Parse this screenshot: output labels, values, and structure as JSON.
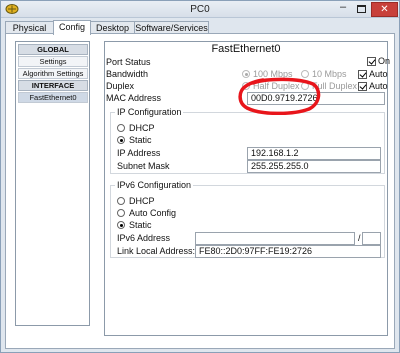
{
  "window": {
    "title": "PC0"
  },
  "tabs": [
    {
      "label": "Physical"
    },
    {
      "label": "Config"
    },
    {
      "label": "Desktop"
    },
    {
      "label": "Software/Services"
    }
  ],
  "sidebar": {
    "items": [
      {
        "label": "GLOBAL"
      },
      {
        "label": "Settings"
      },
      {
        "label": "Algorithm Settings"
      },
      {
        "label": "INTERFACE"
      },
      {
        "label": "FastEthernet0"
      }
    ]
  },
  "panel": {
    "title": "FastEthernet0",
    "port_status": {
      "label": "Port Status",
      "on_label": "On",
      "checked": true
    },
    "bandwidth": {
      "label": "Bandwidth",
      "opt_100": "100 Mbps",
      "opt_10": "10 Mbps",
      "auto_label": "Auto"
    },
    "duplex": {
      "label": "Duplex",
      "opt_half": "Half Duplex",
      "opt_full": "Full Duplex",
      "auto_label": "Auto"
    },
    "mac": {
      "label": "MAC Address",
      "value": "00D0.9719.2726"
    },
    "ipv4": {
      "title": "IP Configuration",
      "dhcp_label": "DHCP",
      "static_label": "Static",
      "ip_label": "IP Address",
      "ip_value": "192.168.1.2",
      "mask_label": "Subnet Mask",
      "mask_value": "255.255.255.0"
    },
    "ipv6": {
      "title": "IPv6 Configuration",
      "dhcp_label": "DHCP",
      "auto_label": "Auto Config",
      "static_label": "Static",
      "addr_label": "IPv6 Address",
      "addr_value": "",
      "prefix_sep": "/",
      "prefix_value": "",
      "link_local_label": "Link Local Address:",
      "link_local_value": "FE80::2D0:97FF:FE19:2726"
    }
  },
  "colors": {
    "annotation": "#e8151b",
    "close_button": "#c8403a"
  }
}
